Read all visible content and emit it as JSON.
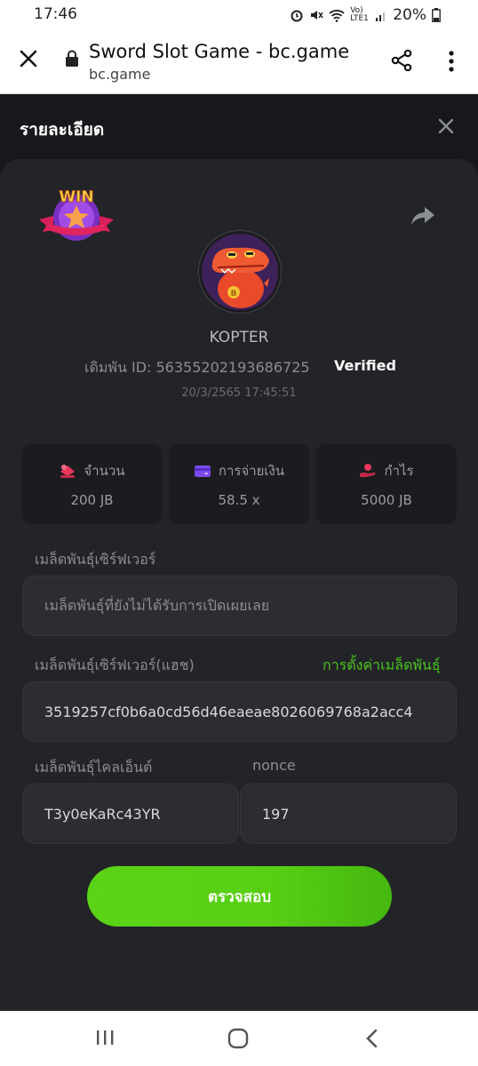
{
  "status_bar": {
    "time": "17:46",
    "battery": "20%",
    "network": "Vo) LTE1"
  },
  "browser": {
    "title": "Sword Slot Game - bc.game",
    "url": "bc.game"
  },
  "page": {
    "title": "รายละเอียด"
  },
  "bet": {
    "username": "KOPTER",
    "bet_id_label": "เดิมพัน ID: 56355202193686725",
    "verified": "Verified",
    "date": "20/3/2565 17:45:51",
    "win_badge": "WIN"
  },
  "stats": [
    {
      "label": "จำนวน",
      "value": "200 JB",
      "icon": "coins-icon",
      "color": "#e8375b"
    },
    {
      "label": "การจ่ายเงิน",
      "value": "58.5 x",
      "icon": "wallet-icon",
      "color": "#7b4bf0"
    },
    {
      "label": "กำไร",
      "value": "5000 JB",
      "icon": "profit-hand-icon",
      "color": "#e8375b"
    }
  ],
  "seeds": {
    "server_seed_label": "เมล็ดพันธุ์เซิร์ฟเวอร์",
    "server_seed_placeholder": "เมล็ดพันธุ์ที่ยังไม่ได้รับการเปิดเผยเลย",
    "server_seed_hash_label": "เมล็ดพันธุ์เซิร์ฟเวอร์(แฮช)",
    "seed_settings_link": "การตั้งค่าเมล็ดพันธุ์",
    "server_seed_hash": "3519257cf0b6a0cd56d46eaeae8026069768a2acc4",
    "client_seed_label": "เมล็ดพันธุ์ไคลเอ็นต์",
    "client_seed": "T3y0eKaRc43YR",
    "nonce_label": "nonce",
    "nonce": "197"
  },
  "actions": {
    "verify": "ตรวจสอบ"
  },
  "colors": {
    "accent_green": "#5bd316",
    "link_green": "#4bc41e",
    "background": "#17181b",
    "card": "#232428"
  }
}
